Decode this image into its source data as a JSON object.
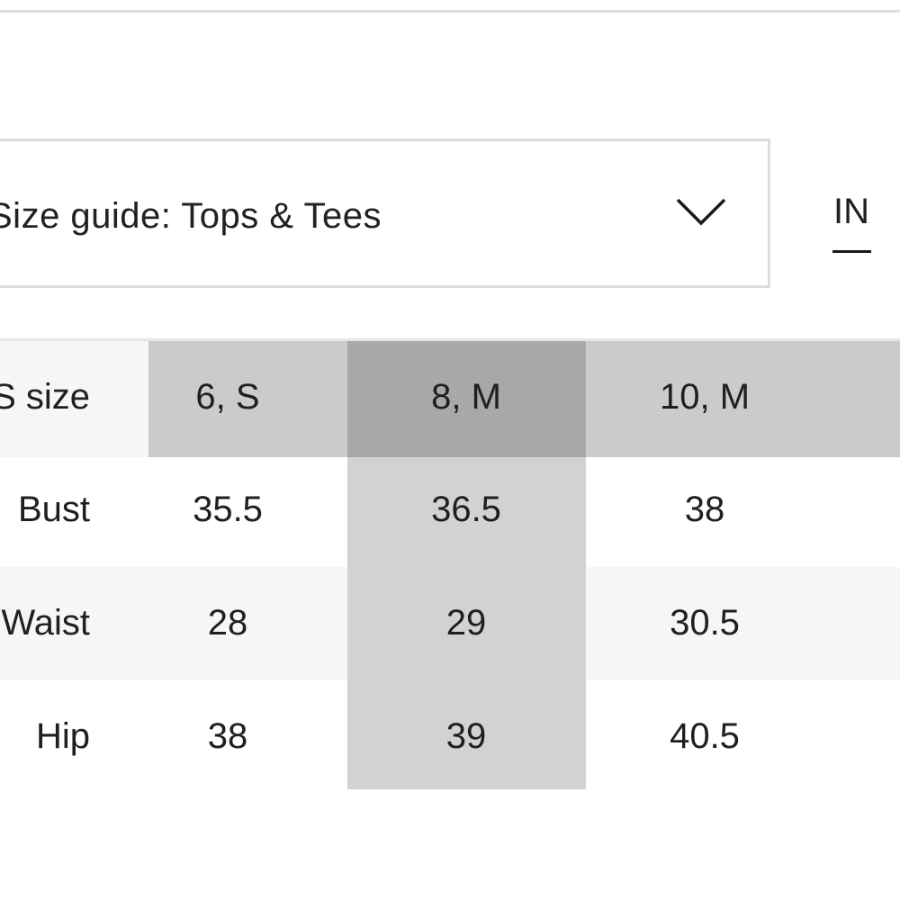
{
  "guide": {
    "label": "Size guide: Tops & Tees",
    "unit": "IN"
  },
  "table": {
    "header_label": "US size",
    "columns": [
      "6, S",
      "8, M",
      "10, M"
    ],
    "rows": [
      {
        "label": "Bust",
        "values": [
          "35.5",
          "36.5",
          "38"
        ]
      },
      {
        "label": "Waist",
        "values": [
          "28",
          "29",
          "30.5"
        ]
      },
      {
        "label": "Hip",
        "values": [
          "38",
          "39",
          "40.5"
        ]
      }
    ],
    "selected_column": "8, M"
  },
  "colors": {
    "header_band": "#cbcbcb",
    "selected_header": "#a8a8a8",
    "selected_column": "#d2d2d2",
    "stripe": "#f6f6f6",
    "border": "#dcdcdc",
    "text": "#1f1f1f"
  },
  "icons": {
    "dropdown": "chevron-down-icon"
  }
}
